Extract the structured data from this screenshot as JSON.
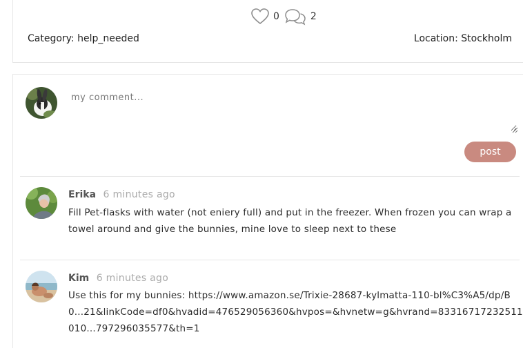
{
  "post": {
    "like_count": "0",
    "comment_count": "2",
    "category": "Category: help_needed",
    "location": "Location: Stockholm"
  },
  "composer": {
    "placeholder": "my comment...",
    "post_label": "post"
  },
  "comments": [
    {
      "author": "Erika",
      "time": "6 minutes ago",
      "text": "Fill Pet-flasks with water (not eniery full) and put in the freezer. When frozen you can wrap a towel around and give the bunnies, mine love to sleep next to these"
    },
    {
      "author": "Kim",
      "time": "6 minutes ago",
      "text": "Use this for my bunnies: https://www.amazon.se/Trixie-28687-kylmatta-110-bl%C3%A5/dp/B0...21&linkCode=df0&hvadid=476529056360&hvpos=&hvnetw=g&hvrand=83316717232511010...797296035577&th=1"
    }
  ],
  "colors": {
    "accent": "#c98a80",
    "border": "#e6e6e6",
    "muted": "#aaaaaa"
  },
  "icons": {
    "like": "heart-icon",
    "comments": "speech-bubbles-icon"
  }
}
